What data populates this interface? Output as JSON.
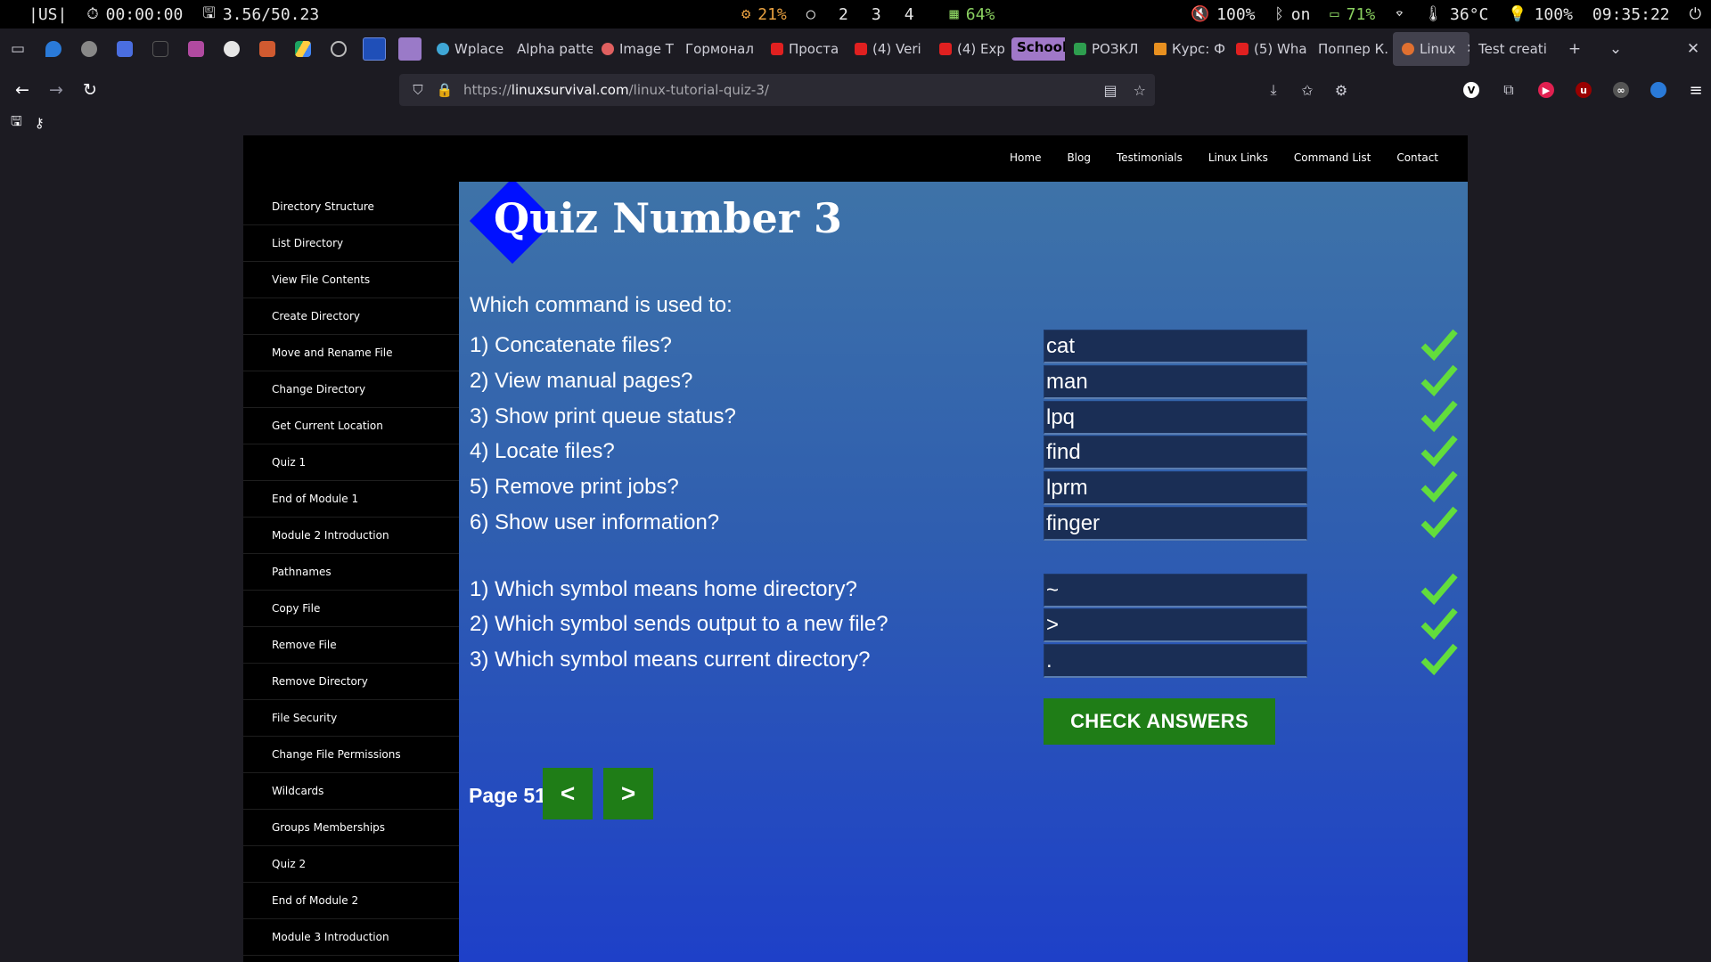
{
  "statusbar": {
    "layout": "|US|",
    "timer": "00:00:00",
    "disk": "3.56/50.23",
    "cpu": "21%",
    "workspaces": [
      "2",
      "3",
      "4"
    ],
    "memory": "64%",
    "volume": "100%",
    "bluetooth": "on",
    "battery": "71%",
    "temperature": "36°C",
    "brightness": "100%",
    "clock": "09:35:22"
  },
  "tabs": [
    {
      "label": "Wplace",
      "color": "#3fa7d6"
    },
    {
      "label": "Alpha patte",
      "color": ""
    },
    {
      "label": "Image T",
      "color": "#e06060"
    },
    {
      "label": "Гормонал",
      "color": ""
    },
    {
      "label": "Проста",
      "color": "#e02020"
    },
    {
      "label": "(4) Veri",
      "color": "#e02020"
    },
    {
      "label": "(4) Exp",
      "color": "#e02020"
    },
    {
      "label": "School",
      "color": "#a078c8"
    },
    {
      "label": "РОЗКЛ",
      "color": "#2e9e4f"
    },
    {
      "label": "Курс: Ф",
      "color": "#e89020"
    },
    {
      "label": "(5) Wha",
      "color": "#e02020"
    },
    {
      "label": "Поппер К.",
      "color": ""
    },
    {
      "label": "Linux",
      "color": "#e07030"
    },
    {
      "label": "Test creati",
      "color": ""
    }
  ],
  "url": {
    "prefix": "https://",
    "domain": "linuxsurvival.com",
    "path": "/linux-tutorial-quiz-3/"
  },
  "topnav": [
    "Home",
    "Blog",
    "Testimonials",
    "Linux Links",
    "Command List",
    "Contact"
  ],
  "sidebar": [
    "Directory Structure",
    "List Directory",
    "View File Contents",
    "Create Directory",
    "Move and Rename File",
    "Change Directory",
    "Get Current Location",
    "Quiz 1",
    "End of Module 1",
    "Module 2 Introduction",
    "Pathnames",
    "Copy File",
    "Remove File",
    "Remove Directory",
    "File Security",
    "Change File Permissions",
    "Wildcards",
    "Groups Memberships",
    "Quiz 2",
    "End of Module 2",
    "Module 3 Introduction"
  ],
  "quiz": {
    "title": "Quiz Number 3",
    "prompt": "Which command is used to:",
    "commands": [
      {
        "q": "1) Concatenate files?",
        "a": "cat"
      },
      {
        "q": "2) View manual pages?",
        "a": "man"
      },
      {
        "q": "3) Show print queue status?",
        "a": "lpq"
      },
      {
        "q": "4) Locate files?",
        "a": "find"
      },
      {
        "q": "5) Remove print jobs?",
        "a": "lprm"
      },
      {
        "q": "6) Show user information?",
        "a": "finger"
      }
    ],
    "symbols": [
      {
        "q": "1) Which symbol means home directory?",
        "a": "~"
      },
      {
        "q": "2) Which symbol sends output to a new file?",
        "a": ">"
      },
      {
        "q": "3) Which symbol means current directory?",
        "a": "."
      }
    ],
    "check_label": "CHECK ANSWERS",
    "page_label": "Page 51",
    "prev_label": "<",
    "next_label": ">"
  },
  "colors": {
    "check_green": "#62dd3c",
    "button_green": "#1f7d17",
    "title_diamond": "#0010ff"
  }
}
